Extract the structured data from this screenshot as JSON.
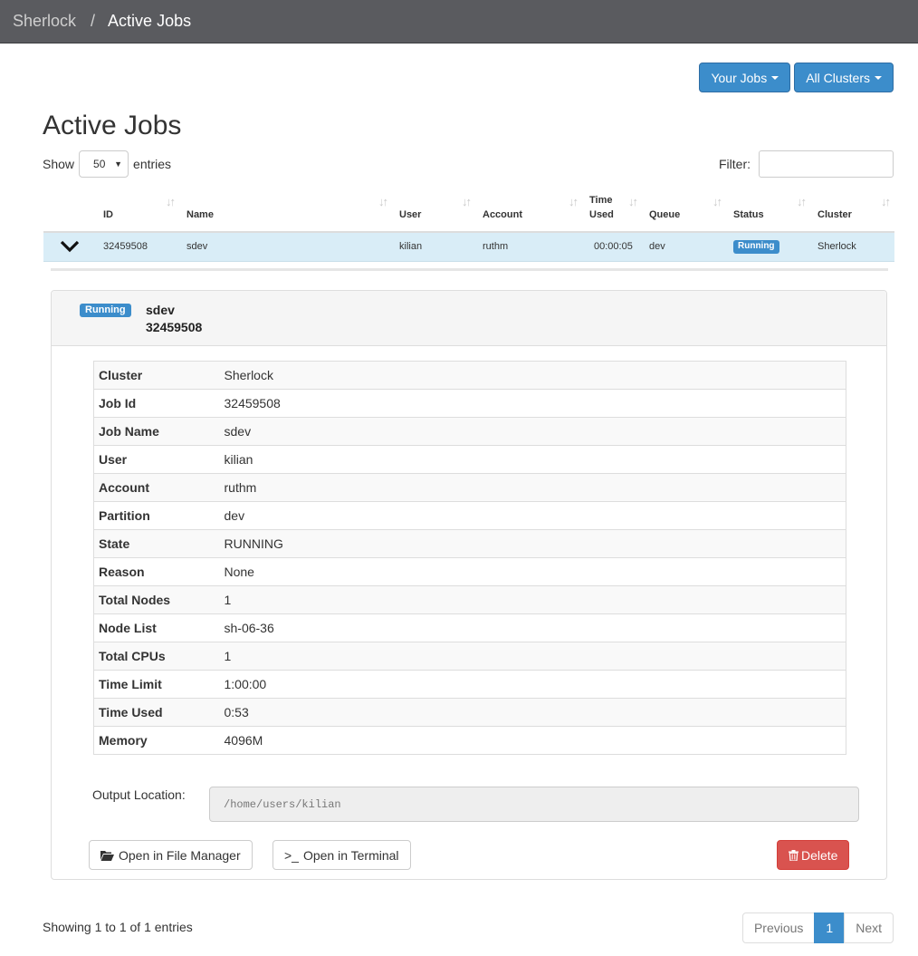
{
  "nav": {
    "root": "Sherlock",
    "separator": "/",
    "current": "Active Jobs"
  },
  "toolbar": {
    "your_jobs": "Your Jobs",
    "all_clusters": "All Clusters"
  },
  "page_title": "Active Jobs",
  "length": {
    "show": "Show",
    "value": "50",
    "entries": "entries"
  },
  "filter": {
    "label": "Filter:",
    "value": ""
  },
  "table": {
    "headers": [
      "ID",
      "Name",
      "User",
      "Account",
      "Time Used",
      "Queue",
      "Status",
      "Cluster"
    ],
    "headers_top": {
      "time_used": "Time",
      "time_used_bottom": "Used"
    },
    "rows": [
      {
        "id": "32459508",
        "name": "sdev",
        "user": "kilian",
        "account": "ruthm",
        "time_used": "00:00:05",
        "queue": "dev",
        "status": "Running",
        "cluster": "Sherlock"
      }
    ]
  },
  "detail": {
    "status": "Running",
    "job_name": "sdev",
    "job_id": "32459508",
    "fields": [
      {
        "k": "Cluster",
        "v": "Sherlock"
      },
      {
        "k": "Job Id",
        "v": "32459508"
      },
      {
        "k": "Job Name",
        "v": "sdev"
      },
      {
        "k": "User",
        "v": "kilian"
      },
      {
        "k": "Account",
        "v": "ruthm"
      },
      {
        "k": "Partition",
        "v": "dev"
      },
      {
        "k": "State",
        "v": "RUNNING"
      },
      {
        "k": "Reason",
        "v": "None"
      },
      {
        "k": "Total Nodes",
        "v": "1"
      },
      {
        "k": "Node List",
        "v": "sh-06-36"
      },
      {
        "k": "Total CPUs",
        "v": "1"
      },
      {
        "k": "Time Limit",
        "v": "1:00:00"
      },
      {
        "k": "Time Used",
        "v": "0:53"
      },
      {
        "k": "Memory",
        "v": "4096M"
      }
    ],
    "output_label": "Output Location:",
    "output_path": "/home/users/kilian",
    "open_files": "Open in File Manager",
    "open_terminal": "Open in Terminal",
    "terminal_prefix": ">_",
    "delete": "Delete"
  },
  "footer": {
    "info": "Showing 1 to 1 of 1 entries",
    "prev": "Previous",
    "page": "1",
    "next": "Next"
  },
  "colors": {
    "primary": "#3c8dcb",
    "danger": "#d9534f",
    "navbar": "#5a5b5f",
    "selected_row": "#d9edf7"
  },
  "icons": [
    "chevron-down-icon",
    "sort-icon",
    "folder-open-icon",
    "terminal-icon",
    "trash-icon",
    "caret-down-icon"
  ]
}
